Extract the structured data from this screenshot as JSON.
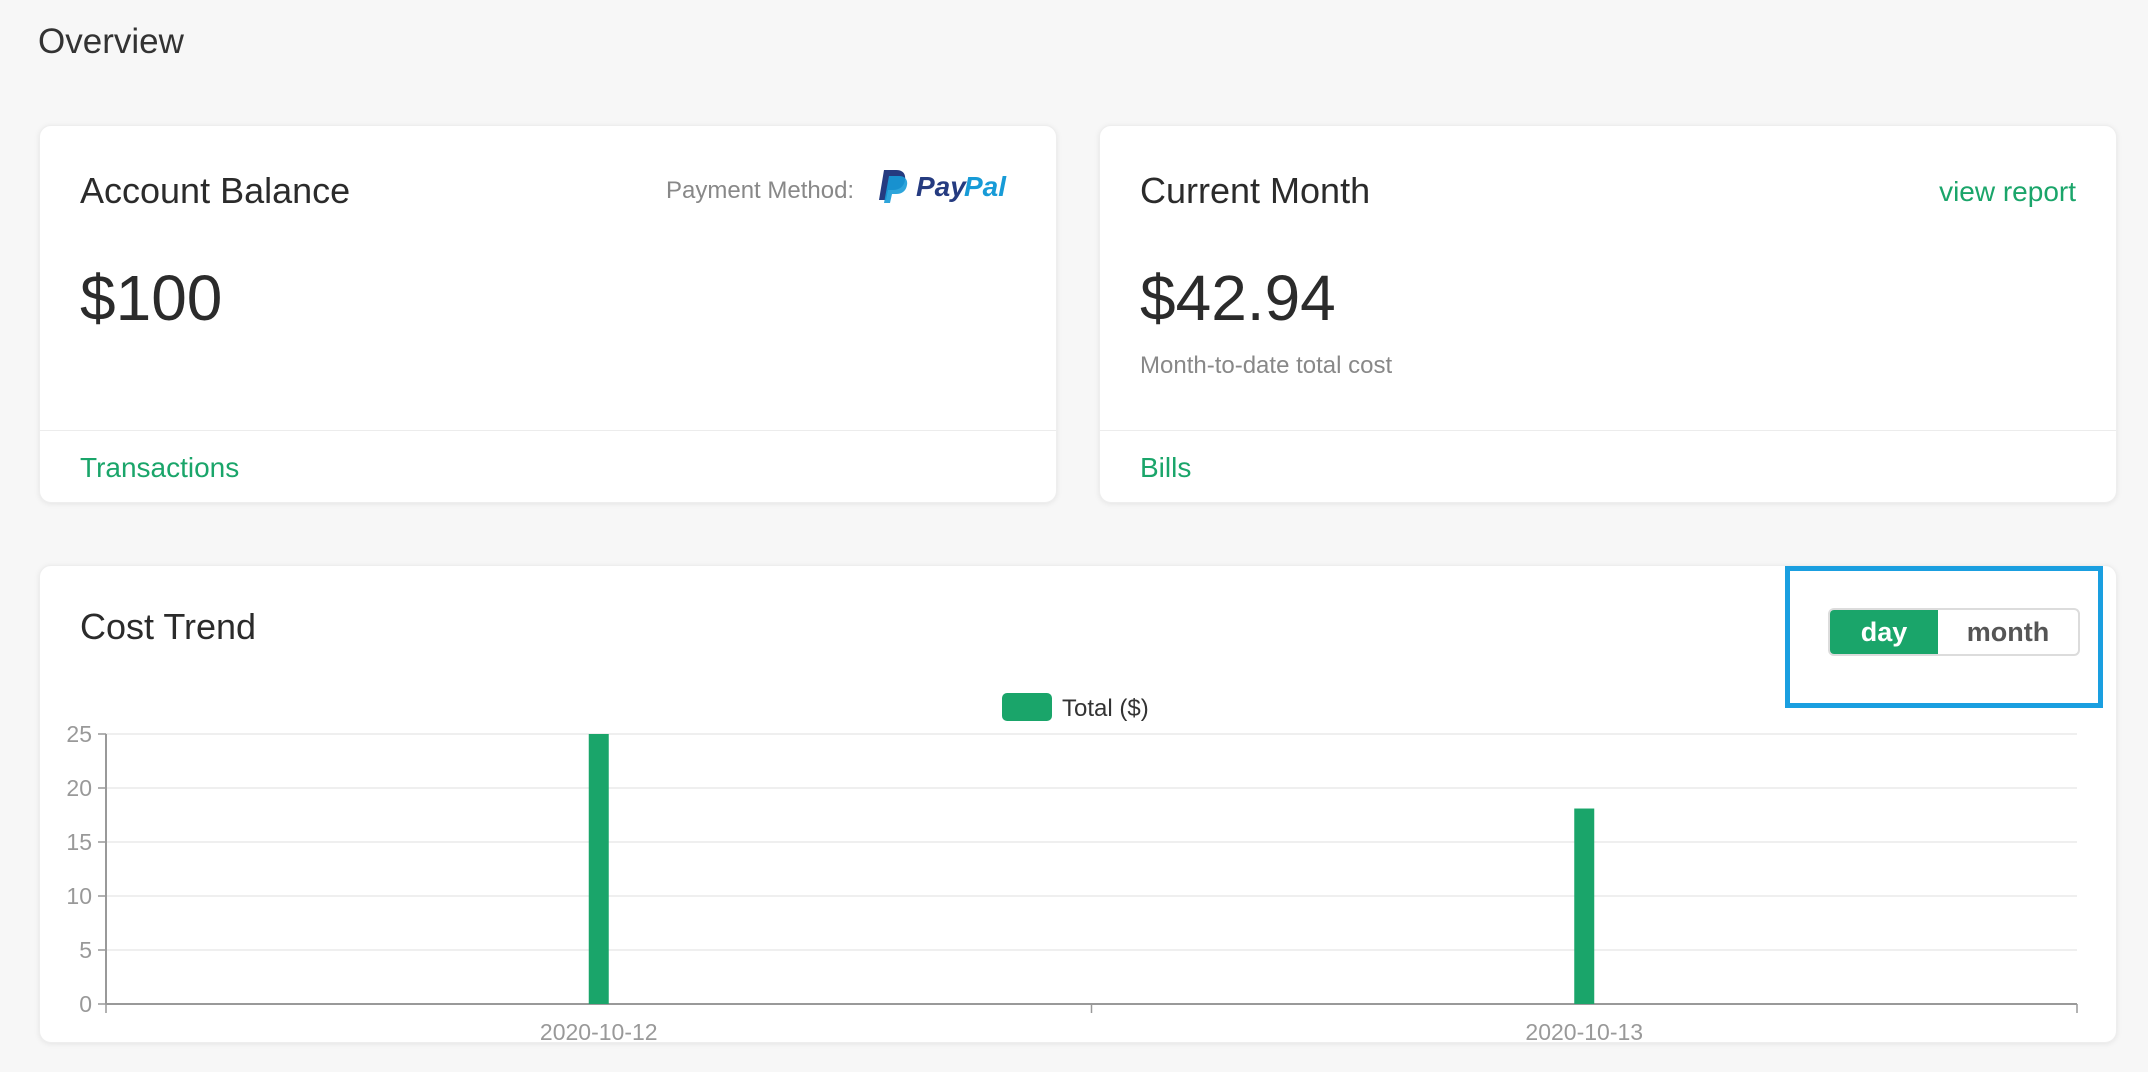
{
  "page": {
    "title": "Overview"
  },
  "balance_card": {
    "title": "Account Balance",
    "payment_label": "Payment Method:",
    "payment_brand": "PayPal",
    "amount": "$100",
    "footer_link": "Transactions"
  },
  "month_card": {
    "title": "Current Month",
    "view_report": "view report",
    "amount": "$42.94",
    "caption": "Month-to-date total cost",
    "footer_link": "Bills"
  },
  "trend_card": {
    "title": "Cost Trend",
    "toggle": {
      "day": "day",
      "month": "month",
      "selected": "day"
    }
  },
  "colors": {
    "accent": "#1aa56a",
    "highlight": "#1a9fe0",
    "paypal_dark": "#253b80",
    "paypal_light": "#179bd7"
  },
  "chart_data": {
    "type": "bar",
    "categories": [
      "2020-10-12",
      "2020-10-13"
    ],
    "series": [
      {
        "name": "Total ($)",
        "values": [
          25,
          18.1
        ]
      }
    ],
    "ylim": [
      0,
      25
    ],
    "yticks": [
      0,
      5,
      10,
      15,
      20,
      25
    ],
    "grid": true,
    "legend": "top-center",
    "title": "",
    "xlabel": "",
    "ylabel": ""
  }
}
